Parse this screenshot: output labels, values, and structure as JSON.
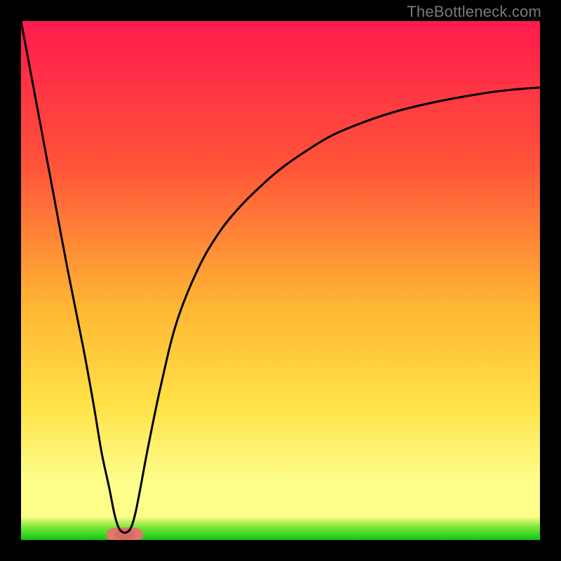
{
  "attribution": "TheBottleneck.com",
  "colors": {
    "frame": "#000000",
    "grad_top": "#ff1a4d",
    "grad_mid_top": "#ff5439",
    "grad_mid": "#ffb634",
    "grad_mid_low": "#ffe247",
    "grad_low": "#fdfd8a",
    "grad_base_edge": "#7be83a",
    "grad_base": "#11c612",
    "curve": "#000000",
    "salmon": "#e0766c",
    "salmon_core": "#d76a62"
  },
  "chart_data": {
    "type": "line",
    "title": "",
    "xlabel": "",
    "ylabel": "",
    "xlim": [
      0,
      100
    ],
    "ylim": [
      0,
      100
    ],
    "curve": {
      "name": "bottleneck-curve",
      "x": [
        0,
        3,
        6,
        9,
        12,
        14,
        15.5,
        17,
        18,
        18.8,
        19.6,
        20.4,
        21.2,
        22,
        23,
        24.5,
        27,
        30,
        34,
        38,
        42,
        46,
        50,
        55,
        60,
        66,
        72,
        78,
        84,
        90,
        95,
        100
      ],
      "y": [
        100,
        84,
        68,
        52,
        37,
        26,
        17,
        10,
        5,
        2.4,
        1.5,
        1.5,
        2.4,
        5,
        10,
        18,
        30,
        42,
        52,
        59,
        64,
        68,
        71.5,
        75,
        78,
        80.5,
        82.5,
        84,
        85.2,
        86.2,
        86.8,
        87.2
      ]
    },
    "valley_marker": {
      "name": "valley-salmon-blob",
      "cx": 20,
      "cy": 1.2,
      "rx": 3.6,
      "ry": 1.2
    },
    "baseline": {
      "y1": 0,
      "y2": 2.8
    }
  }
}
